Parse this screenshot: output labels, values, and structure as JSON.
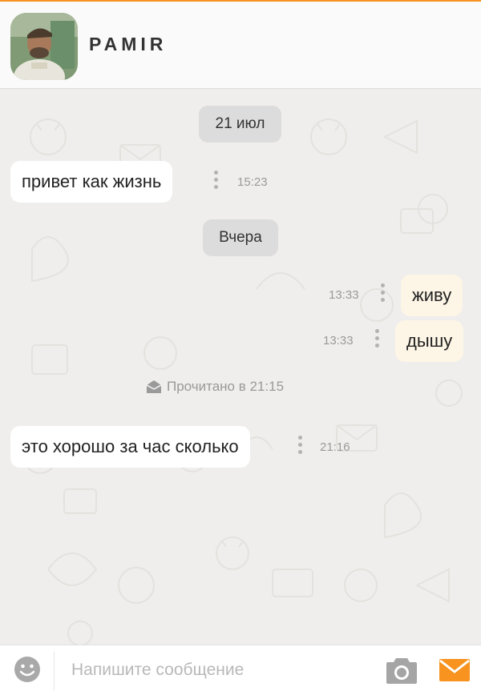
{
  "header": {
    "contact_name": "PAMIR",
    "avatar_icon": "user-avatar-photo"
  },
  "messages": {
    "date_1": "21 июл",
    "incoming_1": {
      "text": "привет как жизнь",
      "time": "15:23"
    },
    "date_2": "Вчера",
    "outgoing_1": {
      "text": "живу",
      "time": "13:33"
    },
    "outgoing_2": {
      "text": "дышу",
      "time": "13:33"
    },
    "read_status": "Прочитано в 21:15",
    "incoming_2": {
      "text": "это хорошо за час сколько",
      "time": "21:16"
    }
  },
  "composer": {
    "placeholder": "Напишите сообщение",
    "emoji_icon": "smiley-icon",
    "camera_icon": "camera-icon",
    "send_icon": "envelope-icon"
  },
  "colors": {
    "accent": "#f7931e",
    "incoming_bubble": "#ffffff",
    "outgoing_bubble": "#fdf5e6",
    "chat_background": "#efeeec"
  }
}
